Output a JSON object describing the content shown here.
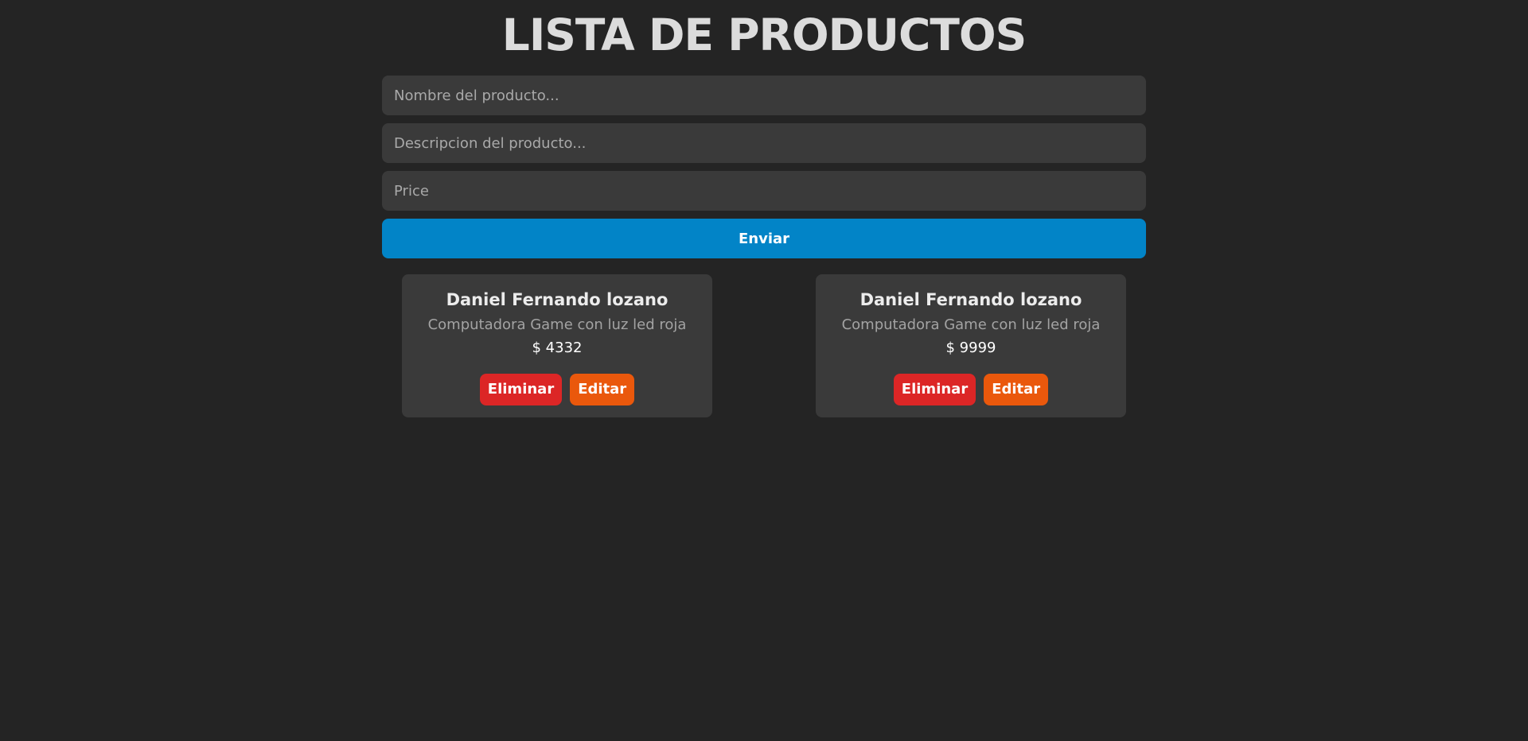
{
  "header": {
    "title": "LISTA DE PRODUCTOS"
  },
  "form": {
    "name": {
      "placeholder": "Nombre del producto...",
      "value": ""
    },
    "description": {
      "placeholder": "Descripcion del producto...",
      "value": ""
    },
    "price": {
      "placeholder": "Price",
      "value": ""
    },
    "submit_label": "Enviar"
  },
  "products": [
    {
      "title": "Daniel Fernando lozano",
      "description": "Computadora Game con luz led roja",
      "price": "$ 4332",
      "delete_label": "Eliminar",
      "edit_label": "Editar"
    },
    {
      "title": "Daniel Fernando lozano",
      "description": "Computadora Game con luz led roja",
      "price": "$ 9999",
      "delete_label": "Eliminar",
      "edit_label": "Editar"
    }
  ],
  "colors": {
    "background": "#242424",
    "surface": "#3a3a3a",
    "primary": "#0284c7",
    "danger": "#dc2626",
    "warning": "#ea580c"
  }
}
